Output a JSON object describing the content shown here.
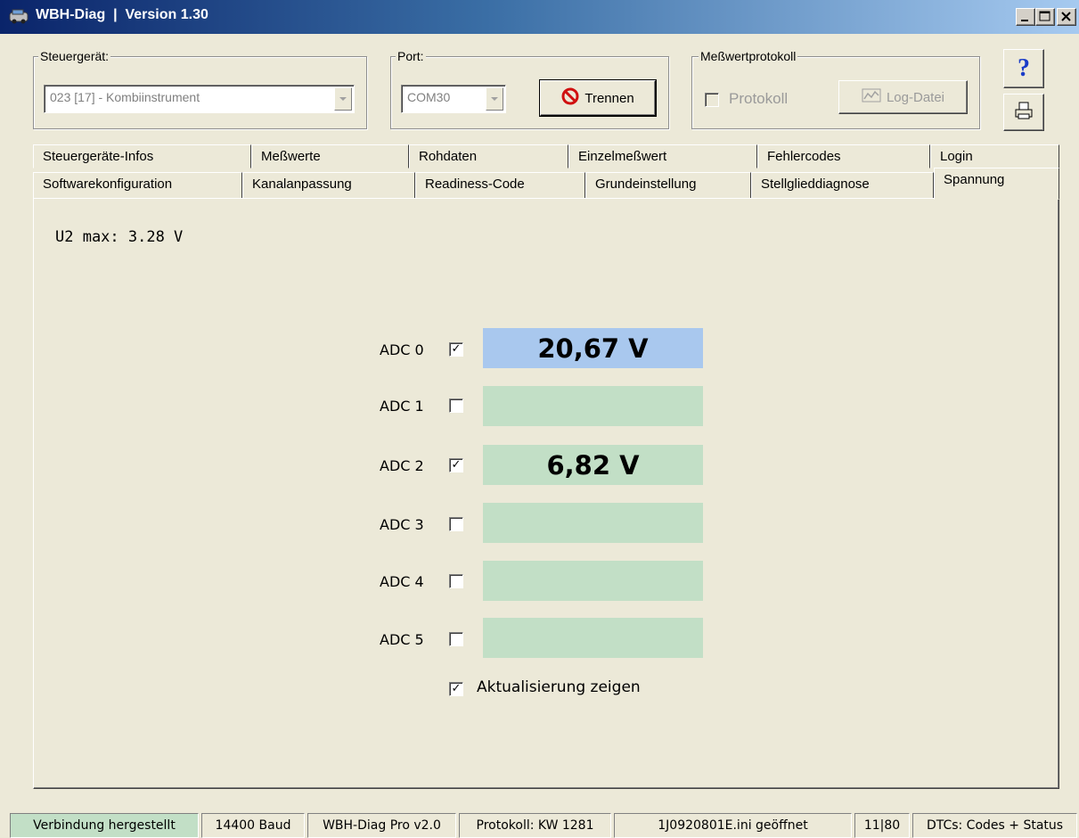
{
  "window": {
    "title": "WBH-Diag  |  Version 1.30"
  },
  "groups": {
    "steuergeraet": {
      "label": "Steuergerät:",
      "value": "023 [17] - Kombiinstrument"
    },
    "port": {
      "label": "Port:",
      "value": "COM30",
      "disconnect_button": "Trennen"
    },
    "messwertprotokoll": {
      "label": "Meßwertprotokoll",
      "protokoll_checkbox": "Protokoll",
      "logfile_button": "Log-Datei"
    }
  },
  "tabs_row1": [
    {
      "label": "Steuergeräte-Infos"
    },
    {
      "label": "Meßwerte"
    },
    {
      "label": "Rohdaten"
    },
    {
      "label": "Einzelmeßwert"
    },
    {
      "label": "Fehlercodes"
    },
    {
      "label": "Login"
    }
  ],
  "tabs_row2": [
    {
      "label": "Softwarekonfiguration"
    },
    {
      "label": "Kanalanpassung"
    },
    {
      "label": "Readiness-Code"
    },
    {
      "label": "Grundeinstellung"
    },
    {
      "label": "Stellglieddiagnose"
    },
    {
      "label": "Spannung"
    }
  ],
  "active_tab": "Spannung",
  "panel": {
    "u2_max": "U2 max: 3.28 V",
    "adc": [
      {
        "label": "ADC 0",
        "checked": true,
        "value": "20,67 V",
        "color": "#a9c8ee"
      },
      {
        "label": "ADC 1",
        "checked": false,
        "value": "",
        "color": "#c2dfc6"
      },
      {
        "label": "ADC 2",
        "checked": true,
        "value": "6,82 V",
        "color": "#c2dfc6"
      },
      {
        "label": "ADC 3",
        "checked": false,
        "value": "",
        "color": "#c2dfc6"
      },
      {
        "label": "ADC 4",
        "checked": false,
        "value": "",
        "color": "#c2dfc6"
      },
      {
        "label": "ADC 5",
        "checked": false,
        "value": "",
        "color": "#c2dfc6"
      }
    ],
    "show_update_label": "Aktualisierung zeigen",
    "show_update_checked": true
  },
  "statusbar": [
    {
      "text": "Verbindung hergestellt",
      "color": "#c2dfc6"
    },
    {
      "text": "14400 Baud"
    },
    {
      "text": "WBH-Diag Pro v2.0"
    },
    {
      "text": "Protokoll: KW 1281"
    },
    {
      "text": "1J0920801E.ini geöffnet"
    },
    {
      "text": "11|80"
    },
    {
      "text": "DTCs: Codes + Status"
    }
  ],
  "icons": {
    "app": "car-diagnostic-icon",
    "help": "question-mark-icon",
    "print": "printer-icon",
    "disconnect": "no-entry-icon",
    "logfile": "chart-icon"
  }
}
